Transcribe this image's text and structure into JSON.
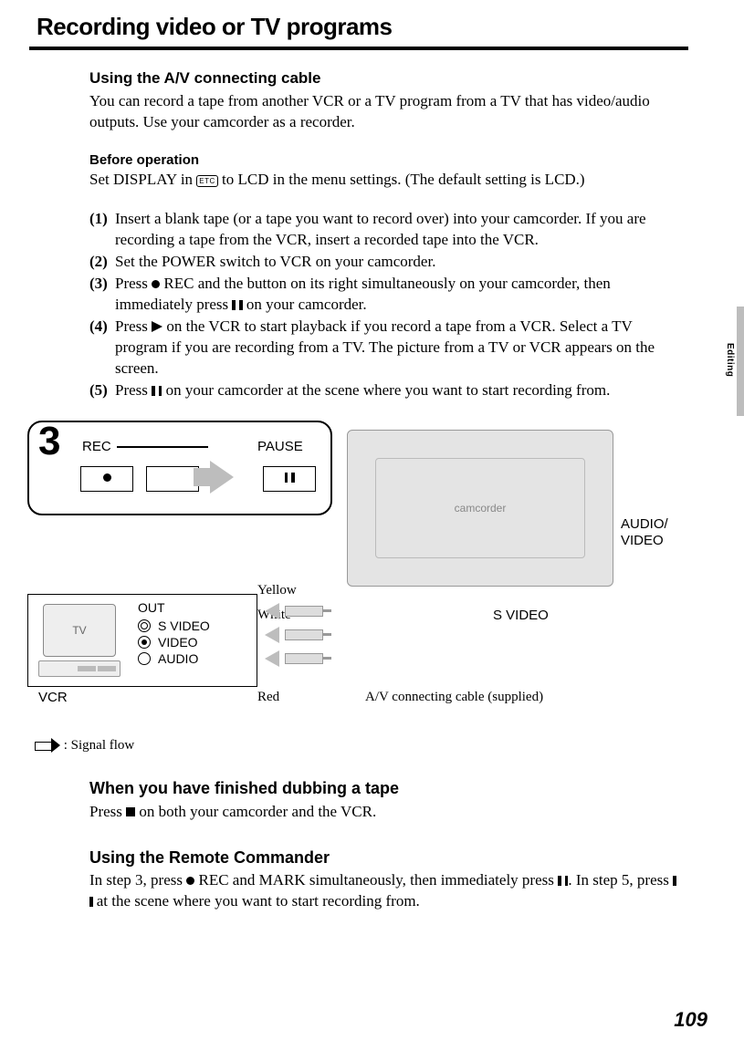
{
  "page": {
    "title": "Recording video or TV programs",
    "number": "109",
    "side_tab": "Editing"
  },
  "sect1": {
    "heading": "Using the A/V connecting cable",
    "para": "You can record a tape from another VCR or a TV program from a TV that has video/audio outputs. Use your camcorder as a recorder."
  },
  "before": {
    "heading": "Before operation",
    "text_a": "Set DISPLAY in ",
    "etc": "ETC",
    "text_b": " to LCD in the menu settings. (The default setting is LCD.)"
  },
  "steps": {
    "n1": "(1)",
    "t1": "Insert a blank tape (or a tape you want to record over) into your camcorder. If you are recording a tape from the VCR, insert a recorded tape into the VCR.",
    "n2": "(2)",
    "t2": "Set the POWER switch to VCR on your camcorder.",
    "n3": "(3)",
    "t3a": "Press ",
    "t3b": " REC and the button on its right simultaneously on your camcorder, then immediately press ",
    "t3c": " on your camcorder.",
    "n4": "(4)",
    "t4a": "Press ",
    "t4b": " on the VCR to start playback if you record a tape from a VCR. Select a TV program if you are recording from a TV. The picture from a TV or VCR appears on the screen.",
    "n5": "(5)",
    "t5a": "Press ",
    "t5b": " on your camcorder at the scene where you want to start recording from."
  },
  "diagram": {
    "step_number": "3",
    "rec": "REC",
    "pause": "PAUSE",
    "audio_video": "AUDIO/\nVIDEO",
    "s_video": "S VIDEO",
    "yellow": "Yellow",
    "white": "White",
    "red": "Red",
    "av_cable": "A/V connecting cable (supplied)",
    "tv": "TV",
    "vcr": "VCR",
    "out": "OUT",
    "video": "VIDEO",
    "audio": "AUDIO"
  },
  "flow": {
    "legend": " : Signal flow"
  },
  "sect2": {
    "heading": "When you have finished dubbing a tape",
    "text_a": "Press ",
    "text_b": " on both your camcorder and the VCR."
  },
  "sect3": {
    "heading": "Using the Remote Commander",
    "text_a": "In step 3, press ",
    "text_b": " REC and MARK simultaneously, then immediately press ",
    "text_c": ". In step 5, press ",
    "text_d": " at the scene where you want to start recording from."
  }
}
